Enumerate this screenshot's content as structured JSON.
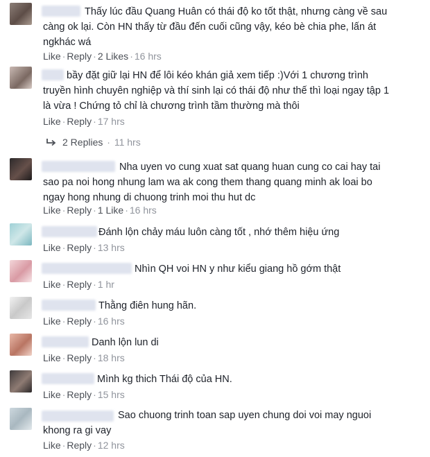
{
  "comments": [
    {
      "text": "Thấy lúc đầu Quang Huân có thái độ ko tốt thật, nhưng càng về sau\ncàng ok lại. Còn HN thấy từ đầu đến cuối cũng vậy, kéo bè chia phe, lấn át\nngkhác wá",
      "like": "Like",
      "reply": "Reply",
      "likes": "2 Likes",
      "time": "16 hrs"
    },
    {
      "text": "bầy đặt giữ lại HN để lôi kéo khán giả xem tiếp :)Với 1 chương trình\ntruyền hình chuyên nghiệp và thí sinh lại có thái độ như thế thì loại ngay tập 1\nlà vừa ! Chứng tỏ chỉ là chương trình tầm thường mà thôi",
      "like": "Like",
      "reply": "Reply",
      "likes": "",
      "time": "17 hrs",
      "replies_label": "2 Replies",
      "replies_time": "11 hrs"
    },
    {
      "text": "Nha uyen vo cung xuat sat quang huan cung co cai hay tai\nsao pa noi hong nhung lam wa ak cong them thang quang minh ak loai bo\nngay hong nhung di chuong trinh moi thu hut dc",
      "like": "Like",
      "reply": "Reply",
      "likes": "1 Like",
      "time": "16 hrs"
    },
    {
      "text": "Đánh lộn chảy máu luôn càng tốt , nhớ thêm hiệu ứng",
      "like": "Like",
      "reply": "Reply",
      "likes": "",
      "time": "13 hrs"
    },
    {
      "text": "Nhìn QH voi HN y như kiểu giang hồ gớm thật",
      "like": "Like",
      "reply": "Reply",
      "likes": "",
      "time": "1 hr"
    },
    {
      "text": "Thằng điên hung hãn.",
      "like": "Like",
      "reply": "Reply",
      "likes": "",
      "time": "16 hrs"
    },
    {
      "text": "Danh lộn lun di",
      "like": "Like",
      "reply": "Reply",
      "likes": "",
      "time": "18 hrs"
    },
    {
      "text": "Mình kg thich Thái độ của HN.",
      "like": "Like",
      "reply": "Reply",
      "likes": "",
      "time": "15 hrs"
    },
    {
      "text": "Sao chuong trinh toan sap uyen chung doi voi may nguoi\nkhong ra gi vay",
      "like": "Like",
      "reply": "Reply",
      "likes": "",
      "time": "12 hrs"
    }
  ]
}
